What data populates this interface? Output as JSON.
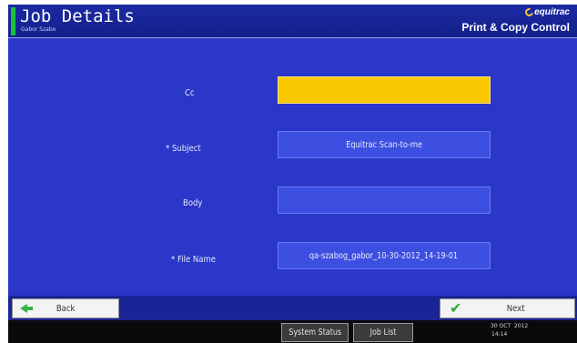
{
  "header": {
    "title": "Job Details",
    "user": "Gabor Szabo",
    "brand": "equitrac",
    "product": "Print & Copy Control"
  },
  "form": {
    "fields": [
      {
        "label": "Cc",
        "value": ""
      },
      {
        "label": "* Subject",
        "value": "Equitrac Scan-to-me"
      },
      {
        "label": "Body",
        "value": ""
      },
      {
        "label": "* File Name",
        "value": "qa-szabog_gabor_10-30-2012_14-19-01"
      }
    ]
  },
  "nav": {
    "back_label": "Back",
    "next_label": "Next"
  },
  "system": {
    "status_label": "System Status",
    "job_list_label": "Job List",
    "date": "30 OCT  2012",
    "time": "14:14"
  },
  "colors": {
    "header_bg": "#1b2aa2",
    "main_bg": "#2a37c8",
    "active_field": "#f9c800",
    "field_bg": "#3d4fe0",
    "accent_green": "#18c33a"
  }
}
